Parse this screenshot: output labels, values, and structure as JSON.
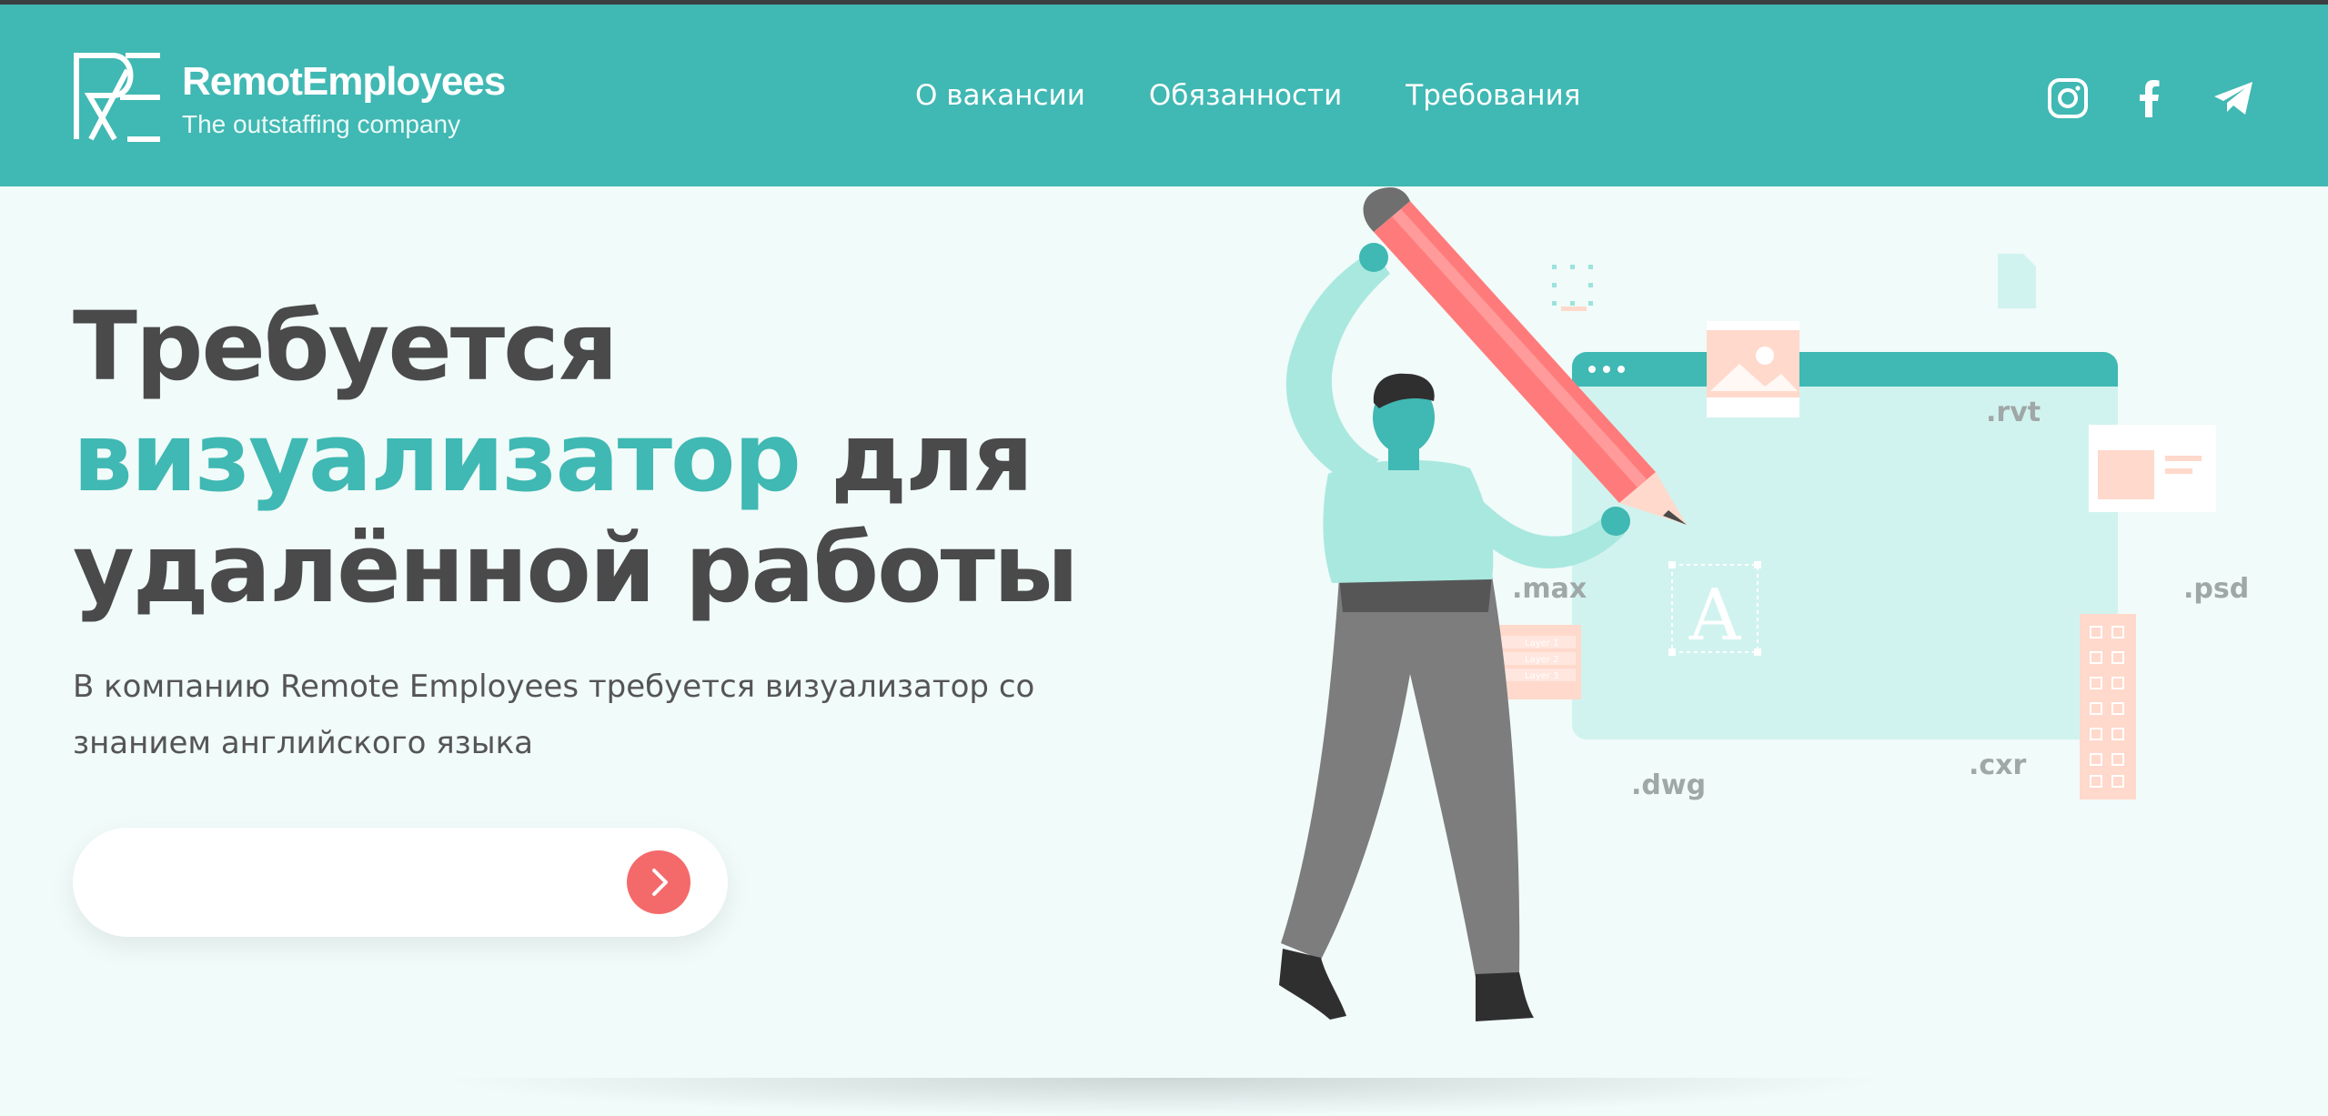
{
  "brand": {
    "name": "RemotEmployees",
    "tagline": "The outstaffing company"
  },
  "nav": {
    "items": [
      {
        "label": "О вакансии"
      },
      {
        "label": "Обязанности"
      },
      {
        "label": "Требования"
      }
    ]
  },
  "social": {
    "icons": [
      "instagram-icon",
      "facebook-icon",
      "telegram-icon"
    ]
  },
  "hero": {
    "title_line1": "Требуется",
    "title_accent": "визуализатор",
    "title_rest1": " для",
    "title_line3": "удалённой работы",
    "subtitle": "В компанию Remote Employees требуется визуализатор со знанием английского языка",
    "input_value": ""
  },
  "illustration": {
    "labels": {
      "rvt": ".rvt",
      "max": ".max",
      "psd": ".psd",
      "dwg": ".dwg",
      "cxr": ".cxr",
      "font_letter": "A",
      "layer1": "Layer 1",
      "layer2": "Layer 2",
      "layer3": "Layer 3"
    }
  },
  "colors": {
    "accent": "#40b8b3",
    "button": "#f46a6b",
    "page_bg": "#f1fbf9",
    "heading": "#4a4a4a"
  }
}
